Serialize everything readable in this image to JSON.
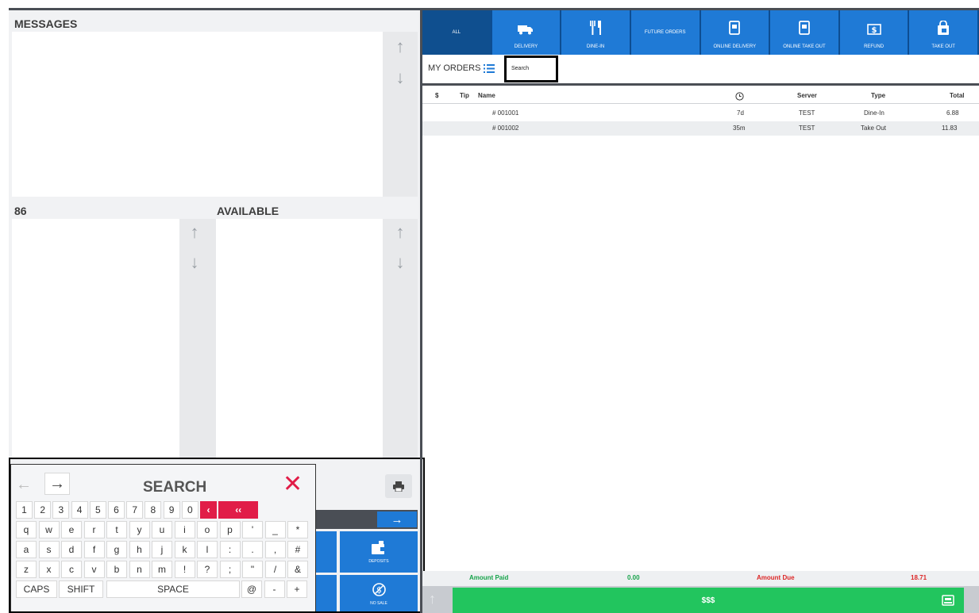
{
  "left": {
    "messages_title": "MESSAGES",
    "eighty_six_title": "86",
    "available_title": "AVAILABLE"
  },
  "tabs": [
    {
      "label": "ALL",
      "icon": "",
      "selected": true
    },
    {
      "label": "DELIVERY",
      "icon": "truck-icon"
    },
    {
      "label": "DINE-IN",
      "icon": "utensils-icon"
    },
    {
      "label": "FUTURE ORDERS",
      "icon": ""
    },
    {
      "label": "ONLINE DELIVERY",
      "icon": "tablet-icon"
    },
    {
      "label": "ONLINE TAKE OUT",
      "icon": "tablet-icon"
    },
    {
      "label": "REFUND",
      "icon": "cash-icon"
    },
    {
      "label": "TAKE OUT",
      "icon": "bag-icon"
    }
  ],
  "orders": {
    "my_orders_label": "MY ORDERS",
    "search_placeholder": "Search",
    "columns": [
      "$",
      "Tip",
      "Name",
      "Server",
      "Type",
      "Total"
    ],
    "rows": [
      {
        "name": "# 001001",
        "time": "7d",
        "server": "TEST",
        "type": "Dine-In",
        "total": "6.88"
      },
      {
        "name": "# 001002",
        "time": "35m",
        "server": "TEST",
        "type": "Take Out",
        "total": "11.83"
      }
    ]
  },
  "summary": {
    "amount_paid_label": "Amount Paid",
    "amount_paid_value": "0.00",
    "amount_due_label": "Amount Due",
    "amount_due_value": "18.71",
    "pay_label": "$$$"
  },
  "keyboard": {
    "title": "SEARCH",
    "row1": [
      "1",
      "2",
      "3",
      "4",
      "5",
      "6",
      "7",
      "8",
      "9",
      "0"
    ],
    "row2": [
      "q",
      "w",
      "e",
      "r",
      "t",
      "y",
      "u",
      "i",
      "o",
      "p",
      "'",
      "_",
      "*"
    ],
    "row3": [
      "a",
      "s",
      "d",
      "f",
      "g",
      "h",
      "j",
      "k",
      "l",
      ":",
      ".",
      ",",
      "#"
    ],
    "row4": [
      "z",
      "x",
      "c",
      "v",
      "b",
      "n",
      "m",
      "!",
      "?",
      ";",
      "\"",
      "/",
      "&"
    ],
    "caps": "CAPS",
    "shift": "SHIFT",
    "space": "SPACE",
    "row5_extra": [
      "@",
      "-",
      "+"
    ]
  },
  "side_buttons": {
    "deposits": "DEPOSITS",
    "no_sale": "NO SALE"
  },
  "colors": {
    "accent_blue": "#1f7ad6",
    "selected_tab": "#0f4f8f",
    "pay_green": "#22c55e",
    "amount_paid_green": "#16a34a",
    "amount_due_red": "#dc2626",
    "delete_red": "#e11d48"
  }
}
